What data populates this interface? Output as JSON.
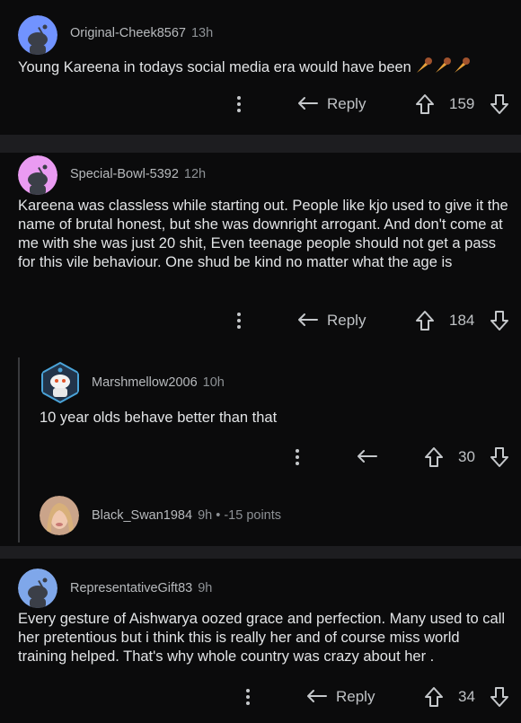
{
  "colors": {
    "background": "#0b0b0c",
    "separator": "#1d1d20",
    "text": "#e2e4e6",
    "meta": "#9a9ea3"
  },
  "icons": {
    "more": "more-vertical-icon",
    "reply": "reply-arrow-icon",
    "upvote": "upvote-arrow-icon",
    "downvote": "downvote-arrow-icon"
  },
  "comments": [
    {
      "user": "Original-Cheek8567",
      "time": "13h",
      "text": "Young Kareena in todays social media era would have been",
      "reply_label": "Reply",
      "score": "159"
    },
    {
      "user": "Special-Bowl-5392",
      "time": "12h",
      "text": "Kareena was classless while starting out. People like kjo used to give it the name of brutal honest, but she was downright arrogant. And don't come at me with she was just 20 shit, Even teenage people should not get a pass for this vile behaviour. One shud be kind no matter what the age is",
      "reply_label": "Reply",
      "score": "184",
      "replies": [
        {
          "user": "Marshmellow2006",
          "time": "10h",
          "text": "10 year olds behave better than that",
          "score": "30"
        },
        {
          "user": "Black_Swan1984",
          "time": "9h",
          "points": "• -15 points"
        }
      ]
    },
    {
      "user": "RepresentativeGift83",
      "time": "9h",
      "text": "Every gesture of Aishwarya oozed grace and perfection. Many used to call her pretentious but i think this is really her and of course miss world training helped. That's why whole country was crazy about her .",
      "reply_label": "Reply",
      "score": "34"
    }
  ]
}
